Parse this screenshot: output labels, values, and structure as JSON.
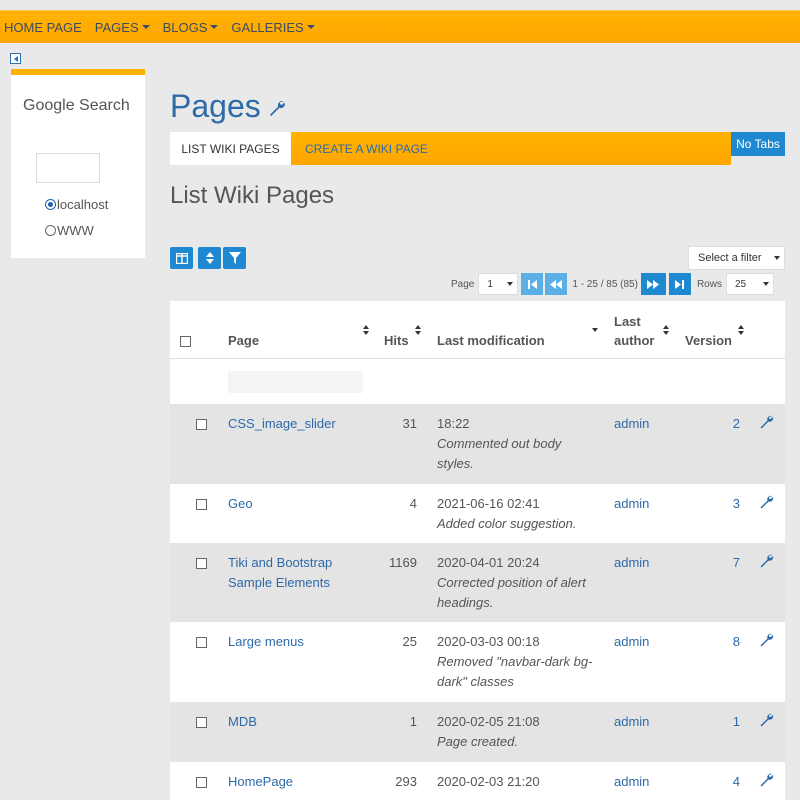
{
  "topnav": {
    "items": [
      {
        "label": "HOME PAGE",
        "has_caret": false
      },
      {
        "label": "PAGES",
        "has_caret": true
      },
      {
        "label": "BLOGS",
        "has_caret": true
      },
      {
        "label": "GALLERIES",
        "has_caret": true
      }
    ]
  },
  "sidebar": {
    "title": "Google Search",
    "options": [
      {
        "label": "localhost",
        "checked": true
      },
      {
        "label": "WWW",
        "checked": false
      }
    ]
  },
  "page": {
    "title": "Pages",
    "tabs": [
      {
        "label": "LIST WIKI PAGES",
        "active": true
      },
      {
        "label": "CREATE A WIKI PAGE",
        "active": false
      }
    ],
    "no_tabs_label": "No Tabs",
    "section_title": "List Wiki Pages"
  },
  "toolbar": {
    "filter_select": "Select a filter"
  },
  "pager": {
    "page_label": "Page",
    "page_value": "1",
    "info": "1 - 25 / 85 (85)",
    "rows_label": "Rows",
    "rows_value": "25"
  },
  "table": {
    "headers": {
      "page": "Page",
      "hits": "Hits",
      "last_modification": "Last modification",
      "last_author_line1": "Last",
      "last_author_line2": "author",
      "version": "Version"
    },
    "rows": [
      {
        "page": [
          "CSS_image_slider"
        ],
        "hits": "31",
        "mod_date": "18:22",
        "mod_note": [
          "Commented out body",
          "styles."
        ],
        "author": "admin",
        "version": "2"
      },
      {
        "page": [
          "Geo"
        ],
        "hits": "4",
        "mod_date": "2021-06-16 02:41",
        "mod_note": [
          "Added color suggestion."
        ],
        "author": "admin",
        "version": "3"
      },
      {
        "page": [
          "Tiki and Bootstrap",
          "Sample Elements"
        ],
        "hits": "1169",
        "mod_date": "2020-04-01 20:24",
        "mod_note": [
          "Corrected position of alert",
          "headings."
        ],
        "author": "admin",
        "version": "7"
      },
      {
        "page": [
          "Large menus"
        ],
        "hits": "25",
        "mod_date": "2020-03-03 00:18",
        "mod_note": [
          "Removed \"navbar-dark bg-",
          "dark\" classes"
        ],
        "author": "admin",
        "version": "8"
      },
      {
        "page": [
          "MDB"
        ],
        "hits": "1",
        "mod_date": "2020-02-05 21:08",
        "mod_note": [
          "Page created."
        ],
        "author": "admin",
        "version": "1"
      },
      {
        "page": [
          "HomePage"
        ],
        "hits": "293",
        "mod_date": "2020-02-03 21:20",
        "mod_note": [],
        "author": "admin",
        "version": "4"
      }
    ]
  },
  "colors": {
    "accent_orange": "#ffa600",
    "link_blue": "#2d6aa8",
    "button_blue": "#1e88d0"
  }
}
